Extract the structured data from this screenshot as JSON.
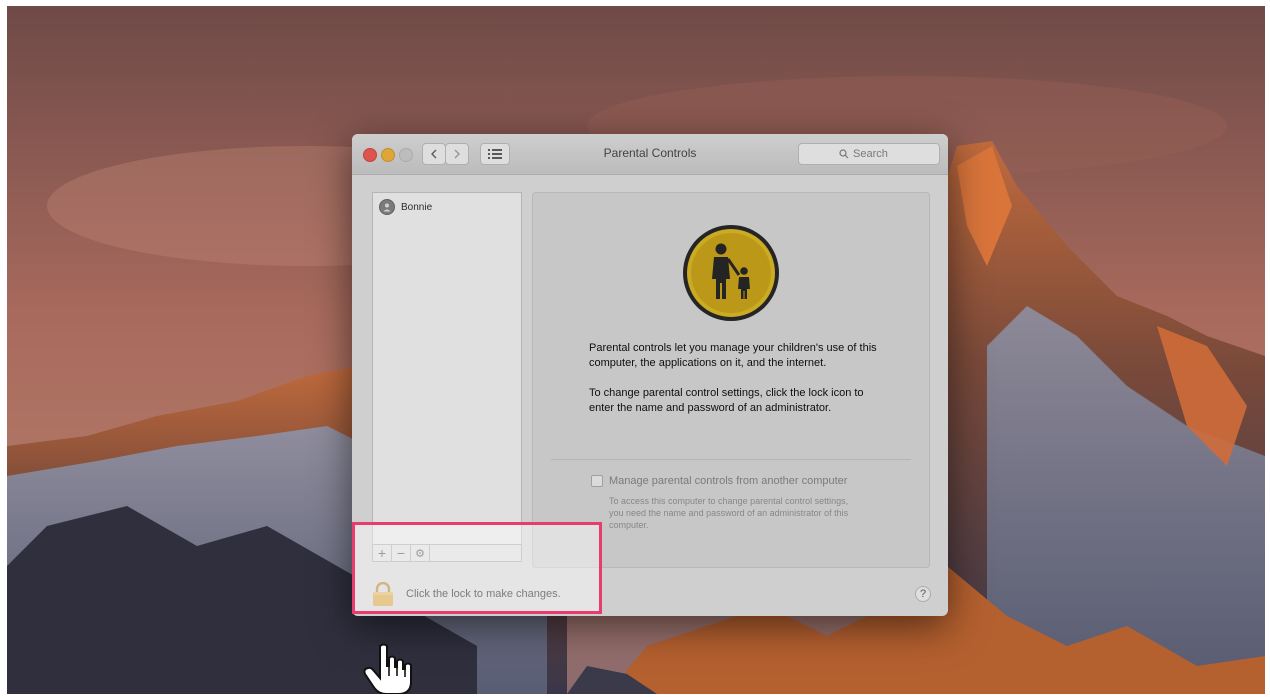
{
  "window": {
    "title": "Parental Controls",
    "search_placeholder": "Search"
  },
  "sidebar": {
    "users": [
      {
        "name": "Bonnie"
      }
    ],
    "toolbar": {
      "add_label": "+",
      "remove_label": "−",
      "action_label": "⚙"
    }
  },
  "main": {
    "description_1": "Parental controls let you manage your children's use of this computer, the applications on it, and the internet.",
    "description_2": "To change parental control settings, click the lock icon to enter the name and password of an administrator.",
    "checkbox_label": "Manage parental controls from another computer",
    "checkbox_checked": false,
    "checkbox_note": "To access this computer to change parental control settings, you need the name and password of an administrator of this computer."
  },
  "footer": {
    "lock_text": "Click the lock to make changes.",
    "help_label": "?"
  },
  "colors": {
    "highlight": "#e83c6e",
    "lock": "#f2b33d",
    "icon_gold": "#e8c229"
  }
}
